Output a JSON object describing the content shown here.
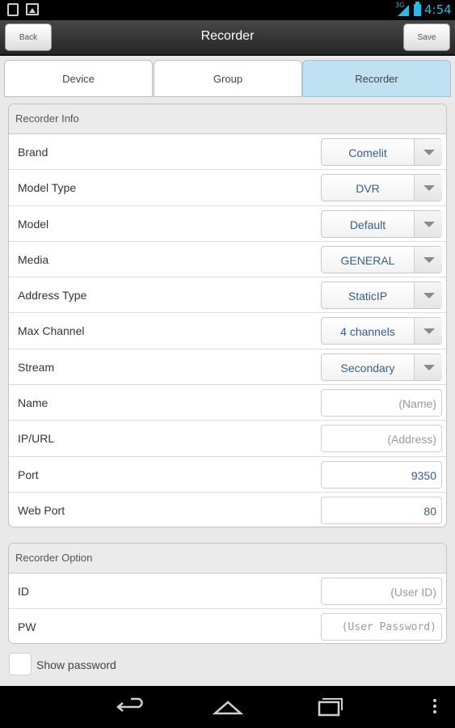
{
  "status_bar": {
    "time": "4:54",
    "network": "3G"
  },
  "action_bar": {
    "title": "Recorder",
    "back_label": "Back",
    "save_label": "Save"
  },
  "tabs": [
    {
      "label": "Device"
    },
    {
      "label": "Group"
    },
    {
      "label": "Recorder",
      "selected": true
    }
  ],
  "recorder_info": {
    "header": "Recorder Info",
    "brand": {
      "label": "Brand",
      "value": "Comelit"
    },
    "model_type": {
      "label": "Model Type",
      "value": "DVR"
    },
    "model": {
      "label": "Model",
      "value": "Default"
    },
    "media": {
      "label": "Media",
      "value": "GENERAL"
    },
    "address_type": {
      "label": "Address Type",
      "value": "StaticIP"
    },
    "max_channel": {
      "label": "Max Channel",
      "value": "4 channels"
    },
    "stream": {
      "label": "Stream",
      "value": "Secondary"
    },
    "name": {
      "label": "Name",
      "placeholder": "(Name)"
    },
    "ip_url": {
      "label": "IP/URL",
      "placeholder": "(Address)"
    },
    "port": {
      "label": "Port",
      "value": "9350"
    },
    "web_port": {
      "label": "Web Port",
      "value": "80"
    }
  },
  "recorder_option": {
    "header": "Recorder Option",
    "id": {
      "label": "ID",
      "placeholder": "(User ID)"
    },
    "pw": {
      "label": "PW",
      "placeholder": "(User Password)"
    }
  },
  "show_password": {
    "label": "Show password",
    "checked": false
  },
  "colors": {
    "accent": "#33b5e5",
    "selected_tab": "#bfe1f2",
    "value_text": "#385f8c"
  }
}
